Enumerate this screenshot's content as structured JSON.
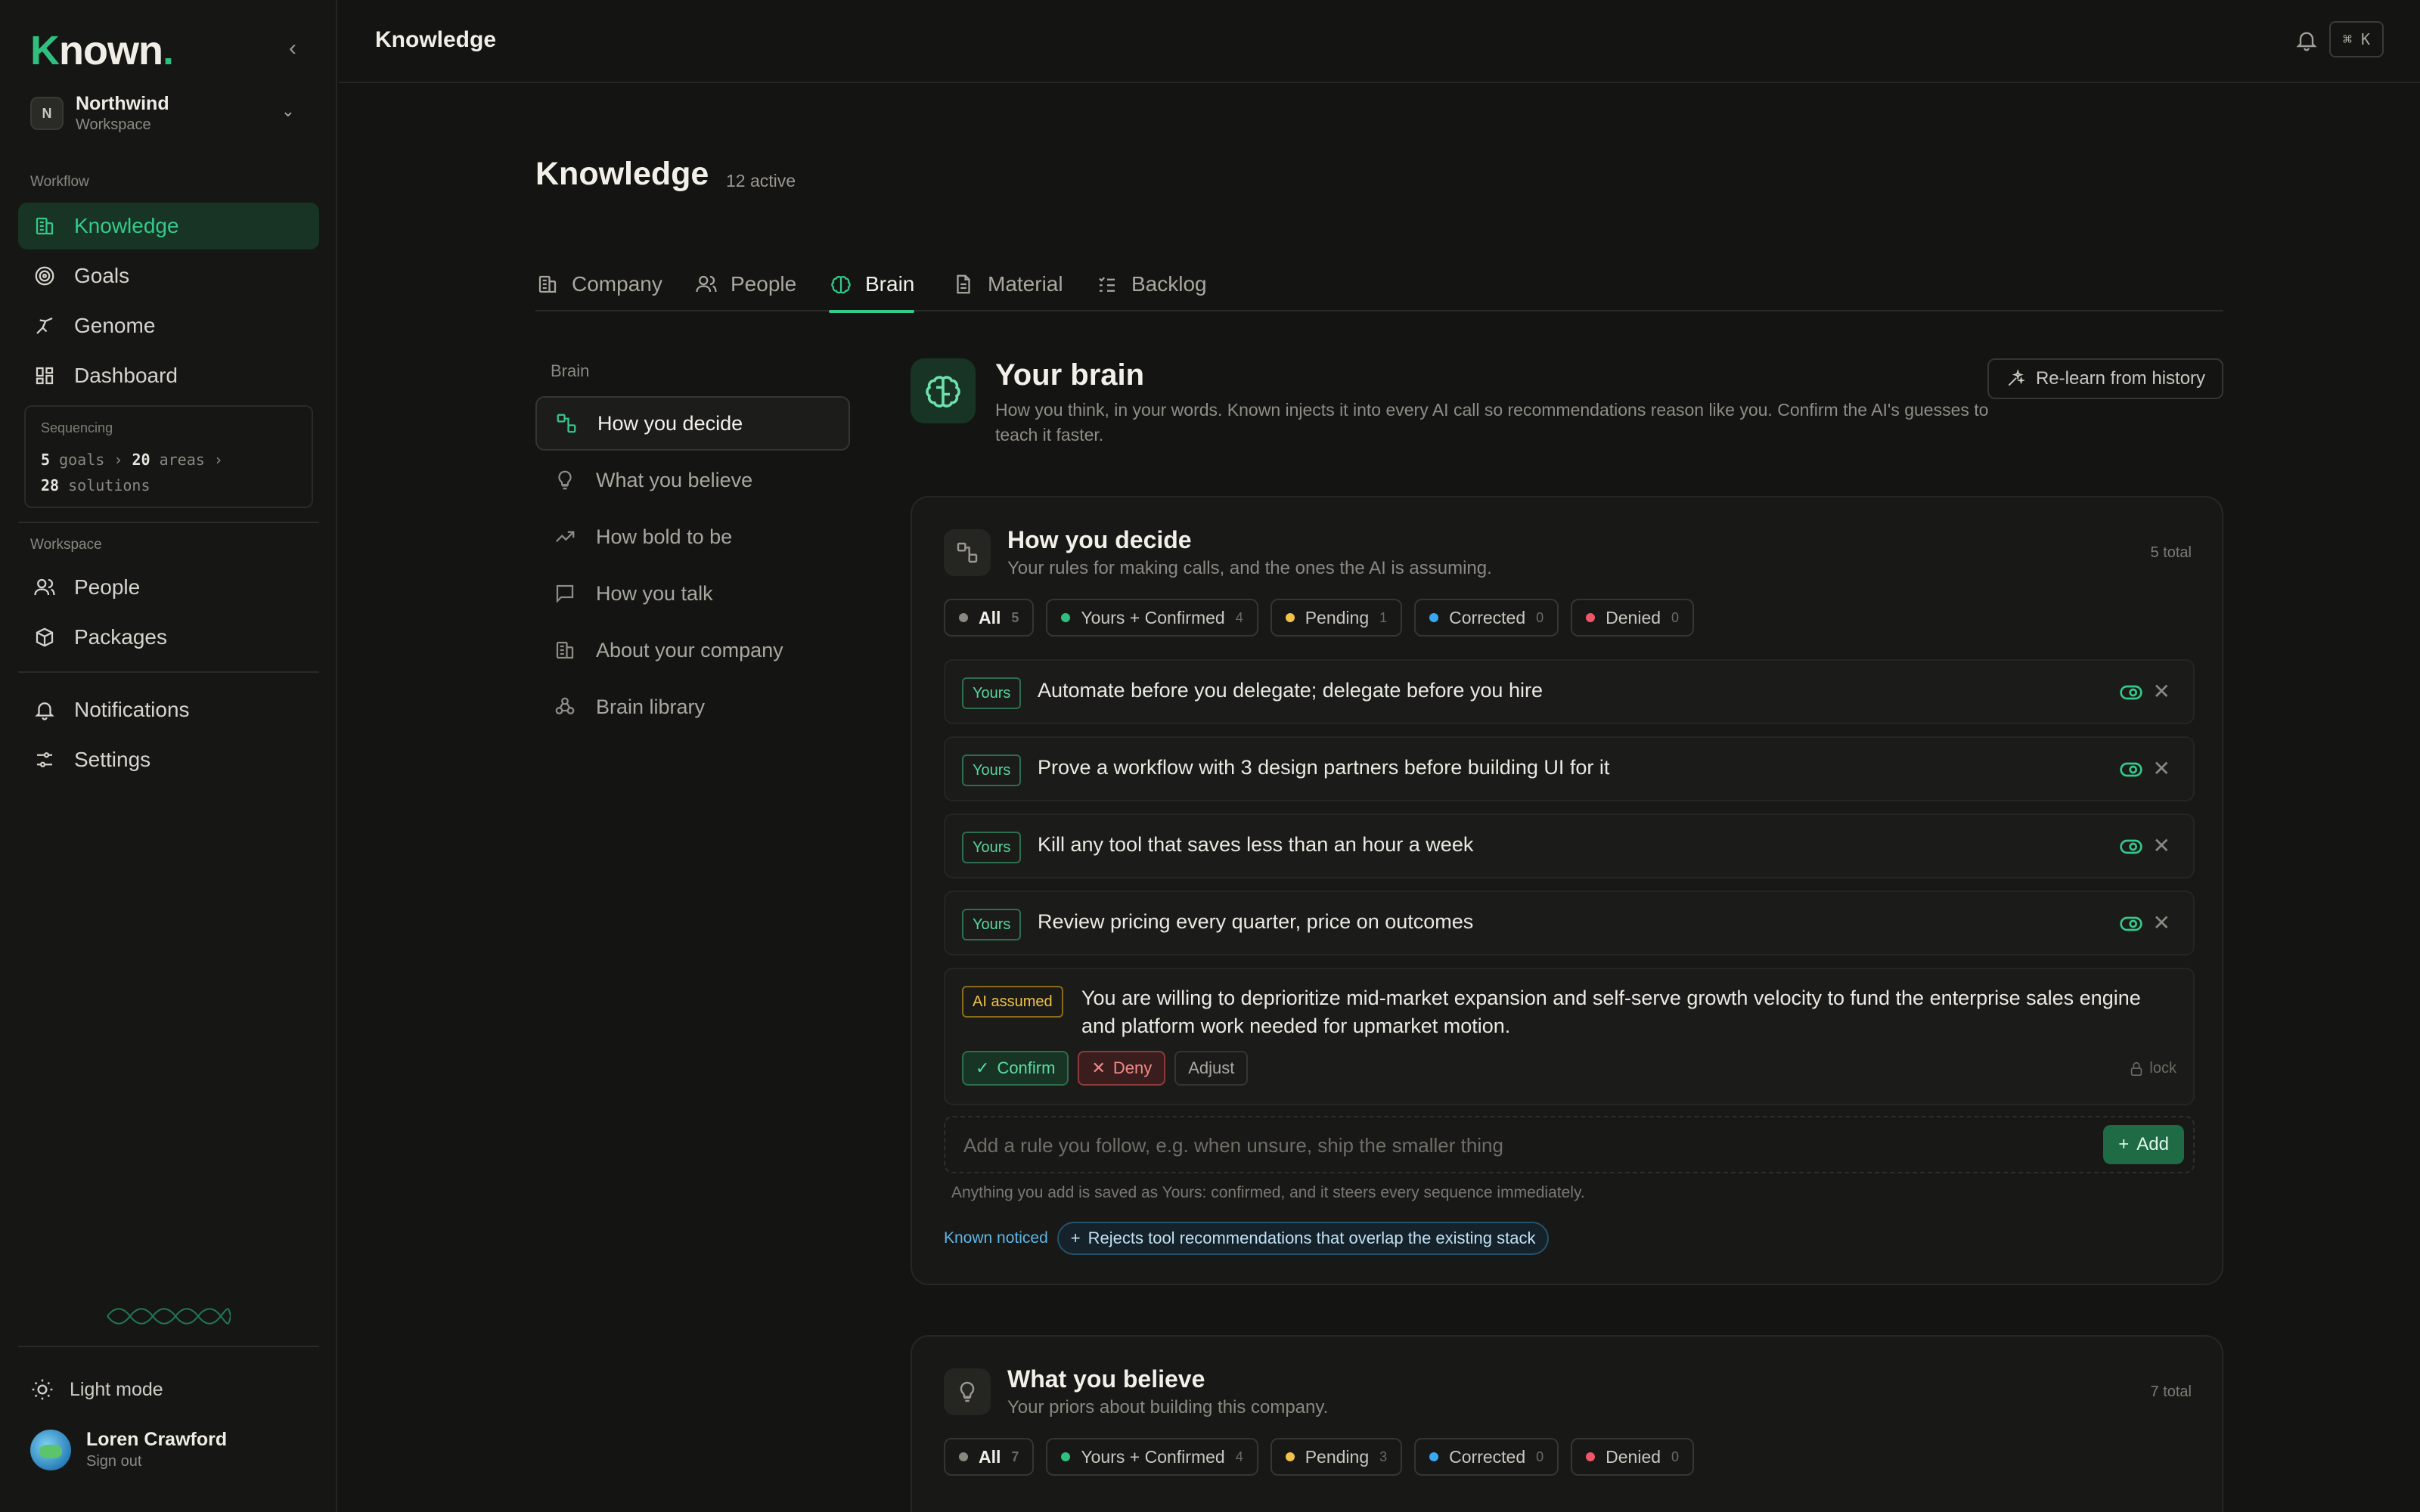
{
  "app": {
    "logo_k": "K",
    "logo_rest": "nown",
    "logo_dot": "."
  },
  "workspace": {
    "initial": "N",
    "name": "Northwind",
    "type": "Workspace"
  },
  "sidebar": {
    "workflow_label": "Workflow",
    "workflow_items": [
      {
        "label": "Knowledge",
        "icon": "building-icon",
        "active": true
      },
      {
        "label": "Goals",
        "icon": "target-icon"
      },
      {
        "label": "Genome",
        "icon": "genome-icon"
      },
      {
        "label": "Dashboard",
        "icon": "grid-icon"
      }
    ],
    "sequencing": {
      "title": "Sequencing",
      "goals_n": "5",
      "goals_label": "goals",
      "areas_n": "20",
      "areas_label": "areas",
      "solutions_n": "28",
      "solutions_label": "solutions"
    },
    "workspace_label": "Workspace",
    "workspace_items": [
      {
        "label": "People",
        "icon": "people-icon"
      },
      {
        "label": "Packages",
        "icon": "package-icon"
      }
    ],
    "bottom_items": [
      {
        "label": "Notifications",
        "icon": "bell-icon"
      },
      {
        "label": "Settings",
        "icon": "sliders-icon"
      }
    ],
    "light_mode": "Light mode",
    "user": {
      "name": "Loren Crawford",
      "action": "Sign out"
    }
  },
  "topbar": {
    "title": "Knowledge",
    "shortcut": "⌘ K"
  },
  "page": {
    "title": "Knowledge",
    "count": "12 active",
    "tabs": [
      {
        "label": "Company",
        "icon": "building-icon"
      },
      {
        "label": "People",
        "icon": "people-icon"
      },
      {
        "label": "Brain",
        "icon": "brain-icon",
        "active": true
      },
      {
        "label": "Material",
        "icon": "document-icon"
      },
      {
        "label": "Backlog",
        "icon": "list-icon"
      }
    ]
  },
  "subnav": {
    "label": "Brain",
    "items": [
      {
        "label": "How you decide",
        "icon": "flow-icon",
        "active": true
      },
      {
        "label": "What you believe",
        "icon": "bulb-icon"
      },
      {
        "label": "How bold to be",
        "icon": "trend-icon"
      },
      {
        "label": "How you talk",
        "icon": "chat-icon"
      },
      {
        "label": "About your company",
        "icon": "building-icon"
      },
      {
        "label": "Brain library",
        "icon": "library-icon"
      }
    ]
  },
  "brain": {
    "title": "Your brain",
    "description": "How you think, in your words. Known injects it into every AI call so recommendations reason like you. Confirm the AI's guesses to teach it faster.",
    "relearn": "Re-learn from history"
  },
  "decide": {
    "title": "How you decide",
    "subtitle": "Your rules for making calls, and the ones the AI is assuming.",
    "total": "5 total",
    "filters": [
      {
        "label": "All",
        "count": "5",
        "color": "#8a8881",
        "active": true
      },
      {
        "label": "Yours + Confirmed",
        "count": "4",
        "color": "#2fbf7f"
      },
      {
        "label": "Pending",
        "count": "1",
        "color": "#f0c24a"
      },
      {
        "label": "Corrected",
        "count": "0",
        "color": "#3aa8f0"
      },
      {
        "label": "Denied",
        "count": "0",
        "color": "#f0566a"
      }
    ],
    "rules": [
      {
        "badge": "Yours",
        "text": "Automate before you delegate; delegate before you hire"
      },
      {
        "badge": "Yours",
        "text": "Prove a workflow with 3 design partners before building UI for it"
      },
      {
        "badge": "Yours",
        "text": "Kill any tool that saves less than an hour a week"
      },
      {
        "badge": "Yours",
        "text": "Review pricing every quarter, price on outcomes"
      }
    ],
    "assumed": {
      "badge": "AI assumed",
      "text": "You are willing to deprioritize mid-market expansion and self-serve growth velocity to fund the enterprise sales engine and platform work needed for upmarket motion.",
      "confirm": "Confirm",
      "deny": "Deny",
      "adjust": "Adjust",
      "lock": "lock"
    },
    "add_placeholder": "Add a rule you follow, e.g. when unsure, ship the smaller thing",
    "add_button": "Add",
    "hint": "Anything you add is saved as Yours: confirmed, and it steers every sequence immediately.",
    "noticed_label": "Known noticed",
    "noticed_chip": "Rejects tool recommendations that overlap the existing stack"
  },
  "believe": {
    "title": "What you believe",
    "subtitle": "Your priors about building this company.",
    "total": "7 total",
    "filters": [
      {
        "label": "All",
        "count": "7",
        "color": "#8a8881",
        "active": true
      },
      {
        "label": "Yours + Confirmed",
        "count": "4",
        "color": "#2fbf7f"
      },
      {
        "label": "Pending",
        "count": "3",
        "color": "#f0c24a"
      },
      {
        "label": "Corrected",
        "count": "0",
        "color": "#3aa8f0"
      },
      {
        "label": "Denied",
        "count": "0",
        "color": "#f0566a"
      }
    ]
  }
}
